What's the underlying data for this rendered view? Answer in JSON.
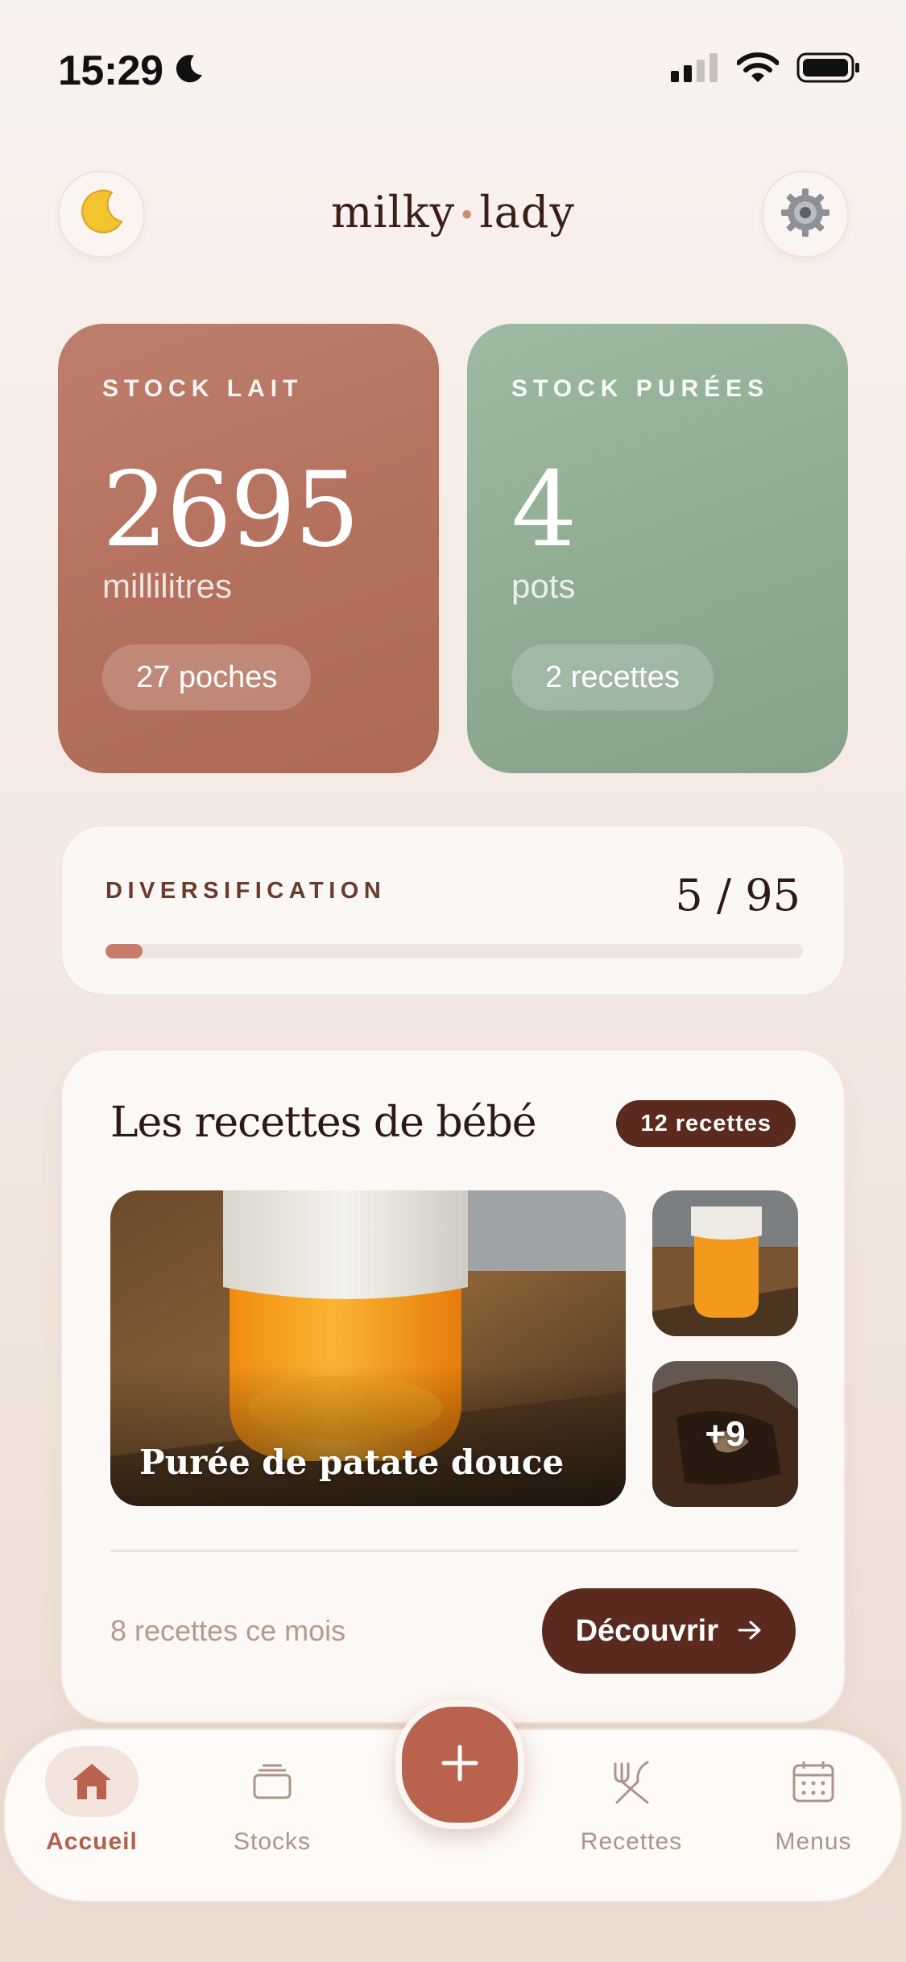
{
  "status_bar": {
    "time": "15:29"
  },
  "header": {
    "brand_left": "milky",
    "brand_right": "lady",
    "night_icon": "crescent-moon-icon",
    "settings_icon": "gear-icon"
  },
  "stock_milk": {
    "label": "STOCK LAIT",
    "value": "2695",
    "unit": "millilitres",
    "pill": "27 poches",
    "color": "#b3705d"
  },
  "stock_puree": {
    "label": "STOCK PURÉES",
    "value": "4",
    "unit": "pots",
    "pill": "2 recettes",
    "color": "#8fab92"
  },
  "diversification": {
    "label": "DIVERSIFICATION",
    "count": "5 / 95",
    "progress": 0.053
  },
  "recipes": {
    "title": "Les recettes de bébé",
    "badge": "12 recettes",
    "featured_caption": "Purée de patate douce",
    "more_count": "+9",
    "month_text": "8 recettes ce mois",
    "cta": "Découvrir"
  },
  "tabbar": {
    "tabs": [
      {
        "label": "Accueil",
        "icon": "home-icon",
        "active": true
      },
      {
        "label": "Stocks",
        "icon": "stack-icon",
        "active": false
      },
      {
        "label": "Recettes",
        "icon": "utensils-icon",
        "active": false
      },
      {
        "label": "Menus",
        "icon": "calendar-icon",
        "active": false
      }
    ],
    "fab_icon": "plus-icon"
  }
}
